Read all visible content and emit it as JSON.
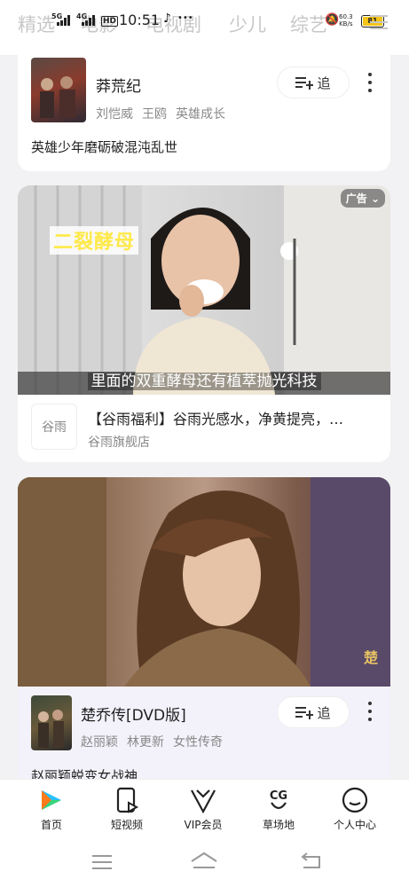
{
  "top_tabs": [
    "精选",
    "电影",
    "电视剧",
    "少儿",
    "综艺"
  ],
  "status_bar": {
    "network_1": "5G",
    "network_2": "4G",
    "hd": "HD",
    "time": "10:51",
    "speed_value": "60.3",
    "speed_unit": "KB/s",
    "battery": "81"
  },
  "card1": {
    "title": "莽荒纪",
    "tags": [
      "刘恺威",
      "王鸥",
      "英雄成长"
    ],
    "follow_label": "追",
    "description": "英雄少年磨砺破混沌乱世"
  },
  "ad_card": {
    "badge": "广告",
    "overlay_text": "二裂酵母",
    "subtitle": "里面的双重酵母还有植萃抛光科技",
    "brand_logo_text": "谷雨",
    "title": "【谷雨福利】谷雨光感水，净黄提亮，…",
    "shop": "谷雨旗舰店"
  },
  "card3": {
    "title": "楚乔传[DVD版]",
    "tags": [
      "赵丽颖",
      "林更新",
      "女性传奇"
    ],
    "follow_label": "追",
    "description": "赵丽颖蜕变女战神"
  },
  "bottom_nav": [
    {
      "label": "首页",
      "icon": "home-icon"
    },
    {
      "label": "短视频",
      "icon": "short-video-icon"
    },
    {
      "label": "VIP会员",
      "icon": "vip-icon"
    },
    {
      "label": "草场地",
      "icon": "caochangdi-icon"
    },
    {
      "label": "个人中心",
      "icon": "profile-icon"
    }
  ],
  "colors": {
    "accent_yellow": "#f5c518",
    "page_bg": "#f2f2f4",
    "highlight_card_bg": "#f3f2fb"
  }
}
